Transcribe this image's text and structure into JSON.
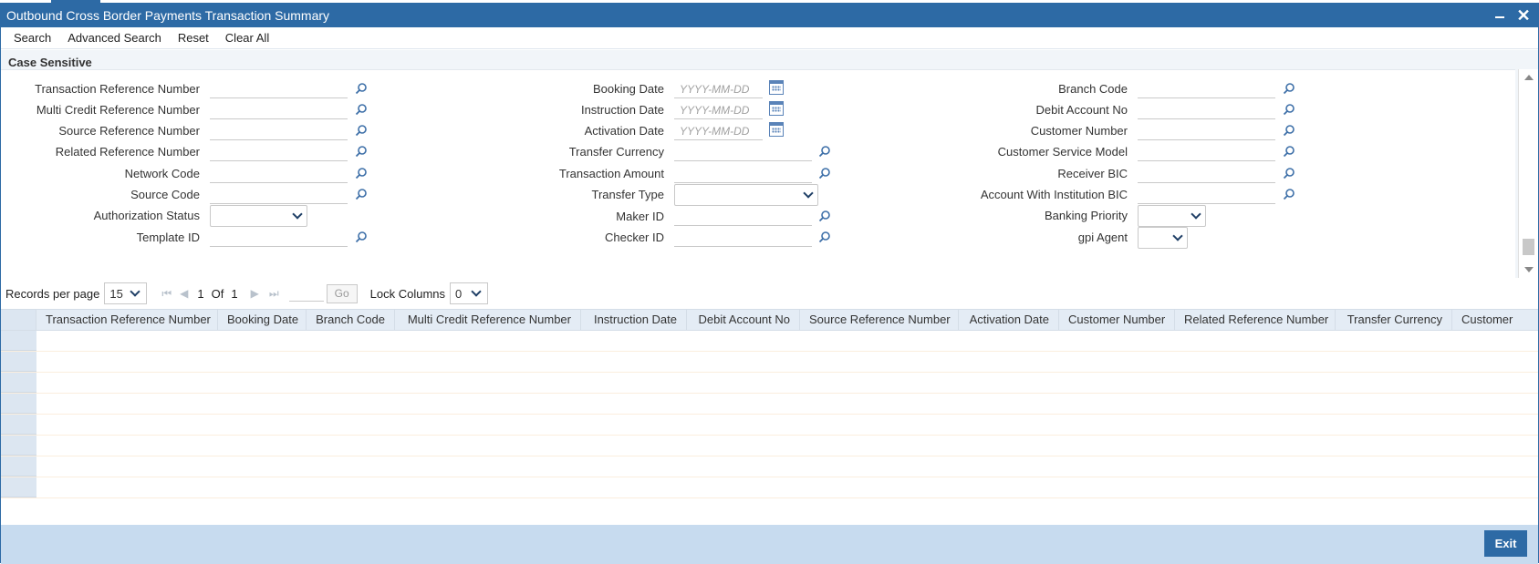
{
  "window": {
    "title": "Outbound Cross Border Payments Transaction Summary"
  },
  "toolbar": {
    "search": "Search",
    "advanced_search": "Advanced Search",
    "reset": "Reset",
    "clear_all": "Clear All"
  },
  "section": {
    "title": "Case Sensitive"
  },
  "fields": {
    "txn_ref": "Transaction Reference Number",
    "multi_credit_ref": "Multi Credit Reference Number",
    "source_ref": "Source Reference Number",
    "related_ref": "Related Reference Number",
    "network_code": "Network Code",
    "source_code": "Source Code",
    "auth_status": "Authorization Status",
    "template_id": "Template ID",
    "booking_date": "Booking Date",
    "instruction_date": "Instruction Date",
    "activation_date": "Activation Date",
    "transfer_currency": "Transfer Currency",
    "transaction_amount": "Transaction Amount",
    "transfer_type": "Transfer Type",
    "maker_id": "Maker ID",
    "checker_id": "Checker ID",
    "branch_code": "Branch Code",
    "debit_account_no": "Debit Account No",
    "customer_number": "Customer Number",
    "customer_service_model": "Customer Service Model",
    "receiver_bic": "Receiver BIC",
    "account_with_institution_bic": "Account With Institution BIC",
    "banking_priority": "Banking Priority",
    "gpi_agent": "gpi Agent",
    "date_placeholder": "YYYY-MM-DD"
  },
  "pager": {
    "records_label": "Records per page",
    "records_value": "15",
    "page": "1",
    "of_label": "Of",
    "total": "1",
    "go": "Go",
    "lock_label": "Lock Columns",
    "lock_value": "0"
  },
  "grid": {
    "columns": [
      "Transaction Reference Number",
      "Booking Date",
      "Branch Code",
      "Multi Credit Reference Number",
      "Instruction Date",
      "Debit Account No",
      "Source Reference Number",
      "Activation Date",
      "Customer Number",
      "Related Reference Number",
      "Transfer Currency",
      "Customer"
    ]
  },
  "footer": {
    "exit": "Exit"
  },
  "colors": {
    "primary": "#2d6aa5",
    "footer": "#c7dbef",
    "header_row": "#e4ecf5"
  }
}
